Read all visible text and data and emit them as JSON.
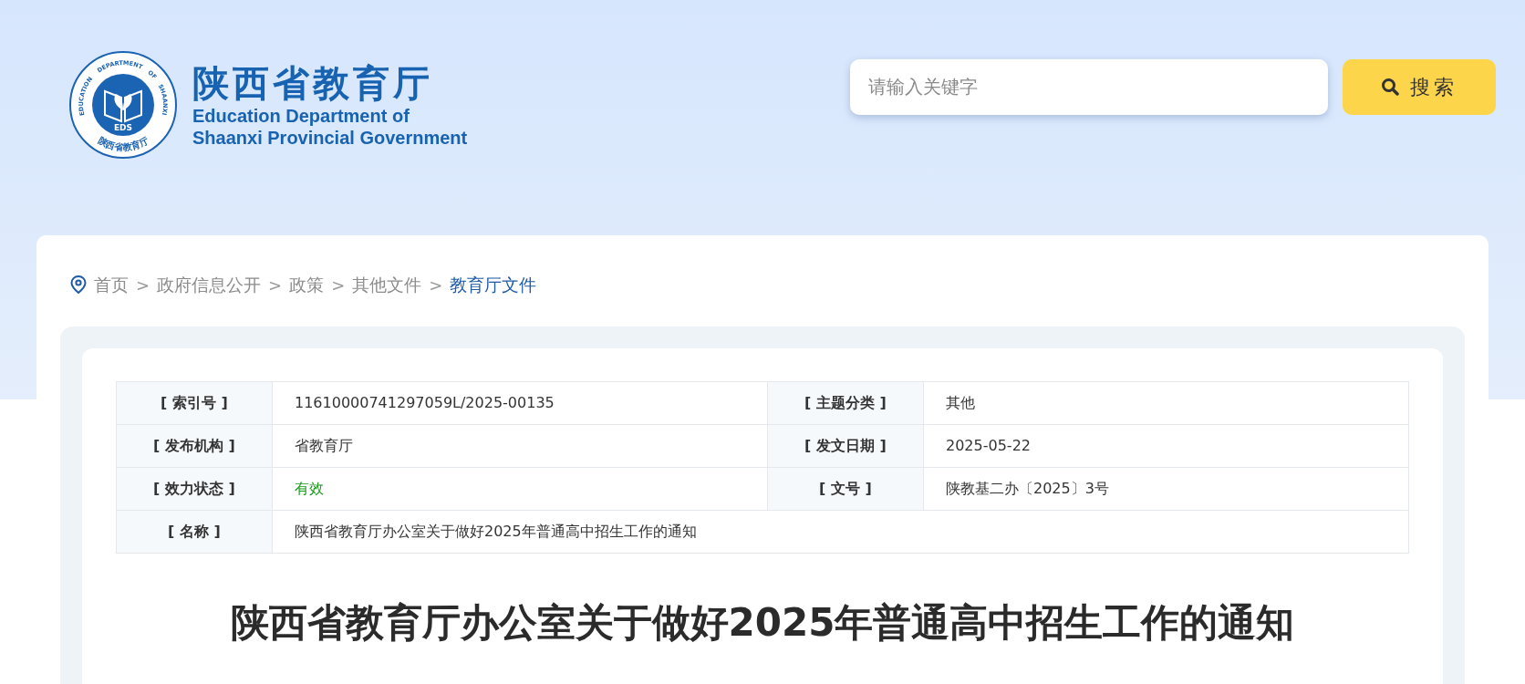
{
  "header": {
    "logo": {
      "ring_text": [
        "EDUCATION",
        "DEPARTMENT",
        "OF",
        "SHAANXI"
      ],
      "abbreviation": "EDS",
      "bottom_text": "陕西省教育厅"
    },
    "title_cn": "陕西省教育厅",
    "title_en": [
      "Education Department of",
      "Shaanxi Provincial Government"
    ]
  },
  "search": {
    "placeholder": "请输入关键字",
    "button": "搜索"
  },
  "breadcrumb": [
    {
      "label": "首页",
      "selected": false
    },
    {
      "label": "政府信息公开",
      "selected": false
    },
    {
      "label": "政策",
      "selected": false
    },
    {
      "label": "其他文件",
      "selected": false
    },
    {
      "label": "教育厅文件",
      "selected": true
    }
  ],
  "breadcrumb_separator": ">",
  "info_table": [
    [
      {
        "label": "[ 索引号 ]",
        "value": "11610000741297059L/2025-00135",
        "kind": "text"
      },
      {
        "label": "[ 主题分类 ]",
        "value": "其他",
        "kind": "text"
      }
    ],
    [
      {
        "label": "[ 发布机构 ]",
        "value": "省教育厅",
        "kind": "text"
      },
      {
        "label": "[ 发文日期 ]",
        "value": "2025-05-22",
        "kind": "text"
      }
    ],
    [
      {
        "label": "[ 效力状态 ]",
        "value": "有效",
        "kind": "status"
      },
      {
        "label": "[ 文号 ]",
        "value": "陕教基二办〔2025〕3号",
        "kind": "text"
      }
    ],
    [
      {
        "label": "[ 名称 ]",
        "value": "陕西省教育厅办公室关于做好2025年普通高中招生工作的通知",
        "kind": "text"
      }
    ]
  ],
  "article": {
    "title": "陕西省教育厅办公室关于做好2025年普通高中招生工作的通知"
  }
}
